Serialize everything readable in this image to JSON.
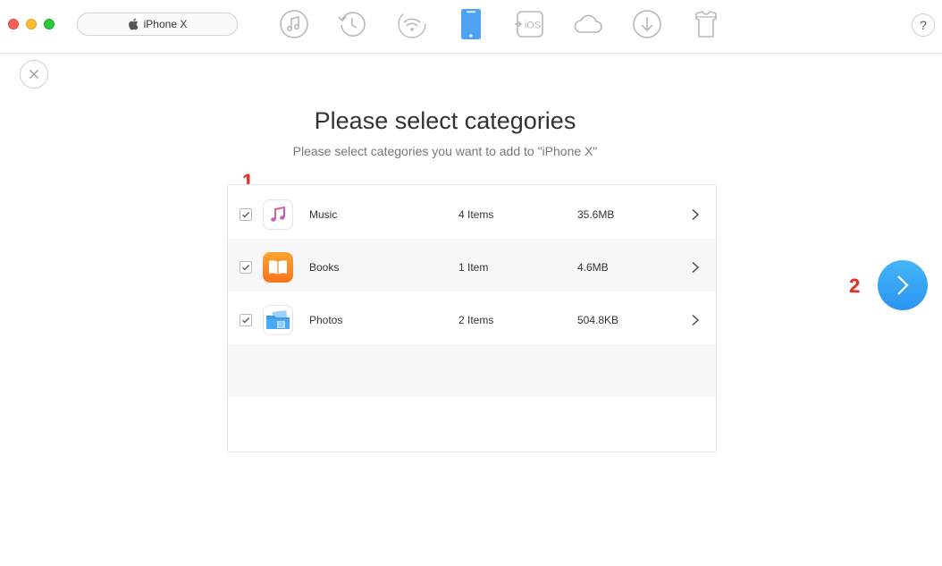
{
  "device": {
    "name": "iPhone X"
  },
  "toolbar": {
    "tools": [
      {
        "icon": "music-icon"
      },
      {
        "icon": "history-icon"
      },
      {
        "icon": "wifi-icon"
      },
      {
        "icon": "phone-icon",
        "active": true
      },
      {
        "icon": "to-ios-icon",
        "label": "iOS"
      },
      {
        "icon": "cloud-icon"
      },
      {
        "icon": "download-icon"
      },
      {
        "icon": "shirt-icon"
      }
    ],
    "help_label": "?"
  },
  "colors": {
    "accent": "#3aa7f5",
    "annotation": "#e0301e"
  },
  "page": {
    "title": "Please select categories",
    "subtitle": "Please select categories you want to add to \"iPhone X\""
  },
  "annotations": {
    "first": "1",
    "second": "2"
  },
  "categories": [
    {
      "name": "Music",
      "count": "4 Items",
      "size": "35.6MB",
      "checked": true,
      "icon": "music-icon"
    },
    {
      "name": "Books",
      "count": "1 Item",
      "size": "4.6MB",
      "checked": true,
      "icon": "books-icon"
    },
    {
      "name": "Photos",
      "count": "2 Items",
      "size": "504.8KB",
      "checked": true,
      "icon": "photos-icon"
    }
  ]
}
